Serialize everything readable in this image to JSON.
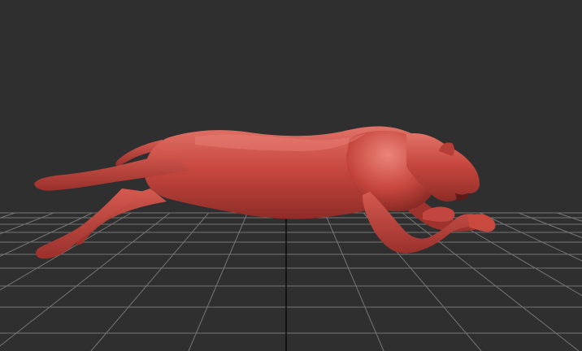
{
  "viewport": {
    "background_color": "#2f2f2f",
    "grid_color": "#767676",
    "grid_axis_color": "#0a0a0a",
    "model": {
      "name": "panther-sculpt",
      "material_color": "#c4463e",
      "shadow_color": "#8a2a26",
      "highlight_color": "#e8776c"
    }
  }
}
